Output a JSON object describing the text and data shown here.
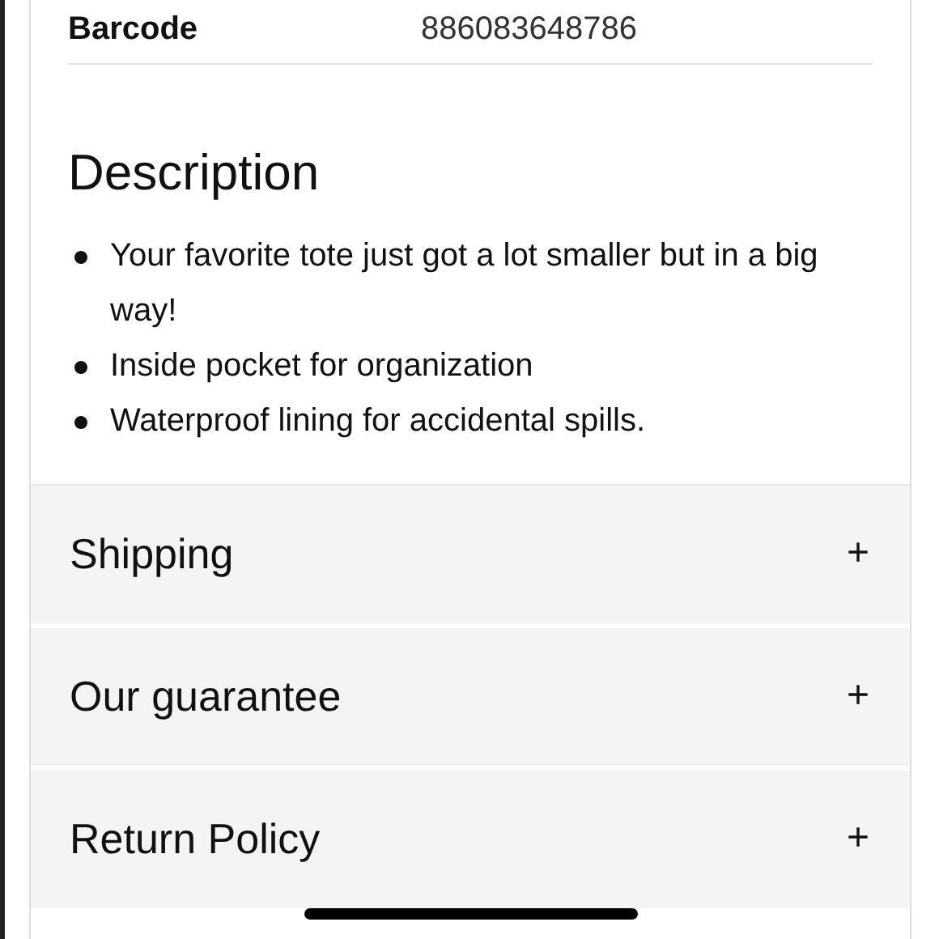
{
  "details": [
    {
      "label": "Barcode",
      "value": "886083648786"
    }
  ],
  "description": {
    "heading": "Description",
    "bullets": [
      "Your favorite tote just got a lot smaller but in a big way!",
      "Inside pocket for organization",
      "Waterproof lining for accidental spills."
    ]
  },
  "accordion": [
    {
      "title": "Shipping",
      "toggle": "+"
    },
    {
      "title": "Our guarantee",
      "toggle": "+"
    },
    {
      "title": "Return Policy",
      "toggle": "+"
    }
  ]
}
